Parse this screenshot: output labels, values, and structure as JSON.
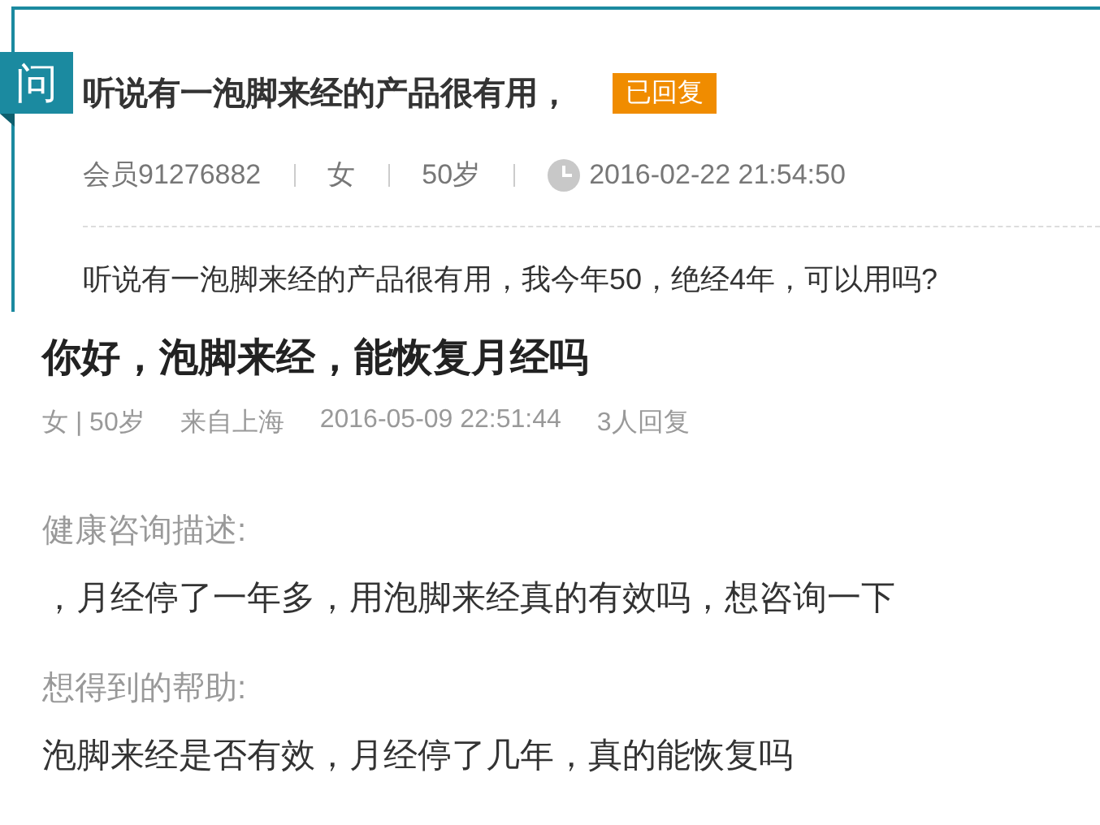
{
  "question_card": {
    "badge": "问",
    "title": "听说有一泡脚来经的产品很有用，",
    "status_tag": "已回复",
    "meta": [
      {
        "kind": "text",
        "text": "会员91276882"
      },
      {
        "kind": "text",
        "text": "女"
      },
      {
        "kind": "text",
        "text": "50岁"
      },
      {
        "kind": "time",
        "text": "2016-02-22 21:54:50"
      }
    ],
    "body": "听说有一泡脚来经的产品很有用，我今年50，绝经4年，可以用吗?"
  },
  "consultation": {
    "title": "你好，泡脚来经，能恢复月经吗",
    "meta": [
      "女 | 50岁",
      "来自上海",
      "2016-05-09 22:51:44",
      "3人回复"
    ],
    "sections": [
      {
        "label": "健康咨询描述:",
        "text": "，月经停了一年多，用泡脚来经真的有效吗，想咨询一下"
      },
      {
        "label": "想得到的帮助:",
        "text": "泡脚来经是否有效，月经停了几年，真的能恢复吗"
      }
    ]
  }
}
